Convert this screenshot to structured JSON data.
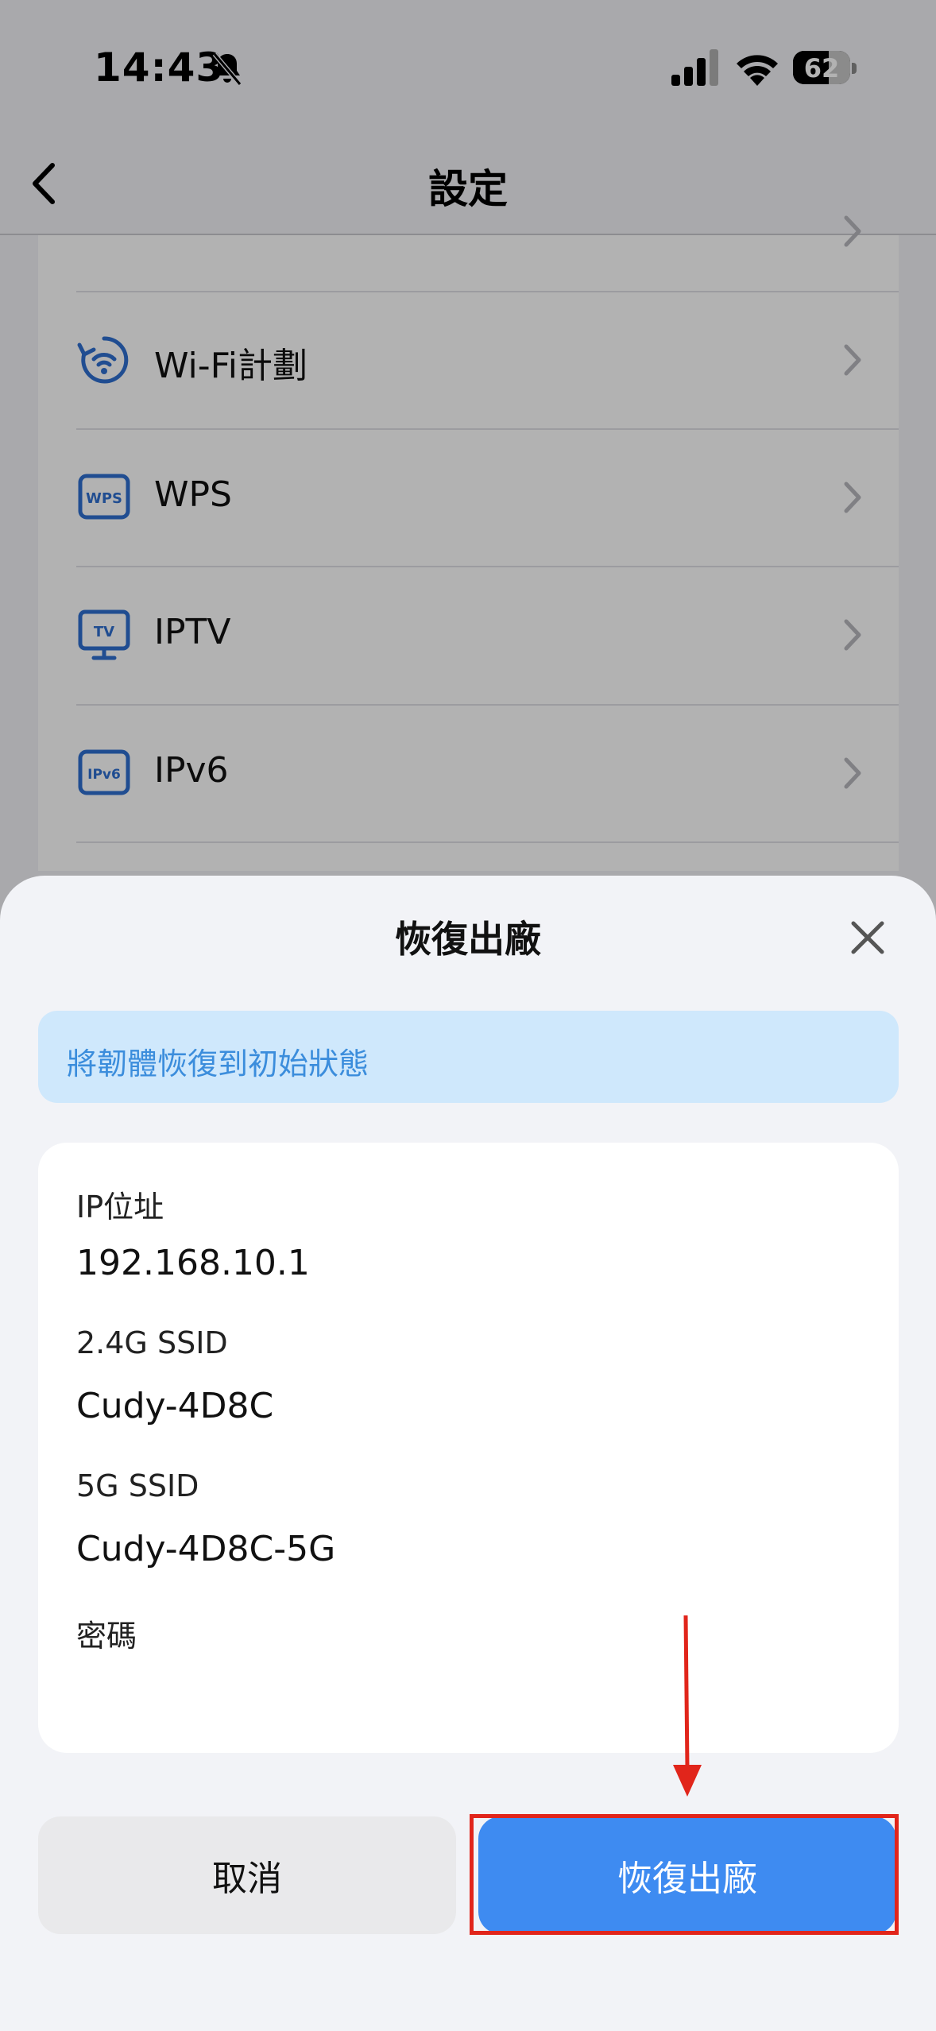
{
  "status_bar": {
    "time": "14:43",
    "battery": "62",
    "battery_level": 0.62
  },
  "nav": {
    "title": "設定"
  },
  "settings_list": [
    {
      "label": "Wi-Fi計劃",
      "icon": "wifi-schedule-icon"
    },
    {
      "label": "WPS",
      "icon": "wps-icon"
    },
    {
      "label": "IPTV",
      "icon": "tv-icon"
    },
    {
      "label": "IPv6",
      "icon": "ipv6-icon"
    }
  ],
  "sheet": {
    "title": "恢復出廠",
    "banner": "將韌體恢復到初始狀態",
    "fields": [
      {
        "label": "IP位址",
        "value": "192.168.10.1"
      },
      {
        "label": "2.4G SSID",
        "value": "Cudy-4D8C"
      },
      {
        "label": "5G SSID",
        "value": "Cudy-4D8C-5G"
      },
      {
        "label": "密碼",
        "value": ""
      }
    ],
    "cancel_label": "取消",
    "reset_label": "恢復出廠"
  },
  "colors": {
    "accent": "#3e8bf1",
    "icon_blue": "#2f6fd0",
    "banner_bg": "#cfe8fc",
    "annotation_red": "#e1251b"
  }
}
